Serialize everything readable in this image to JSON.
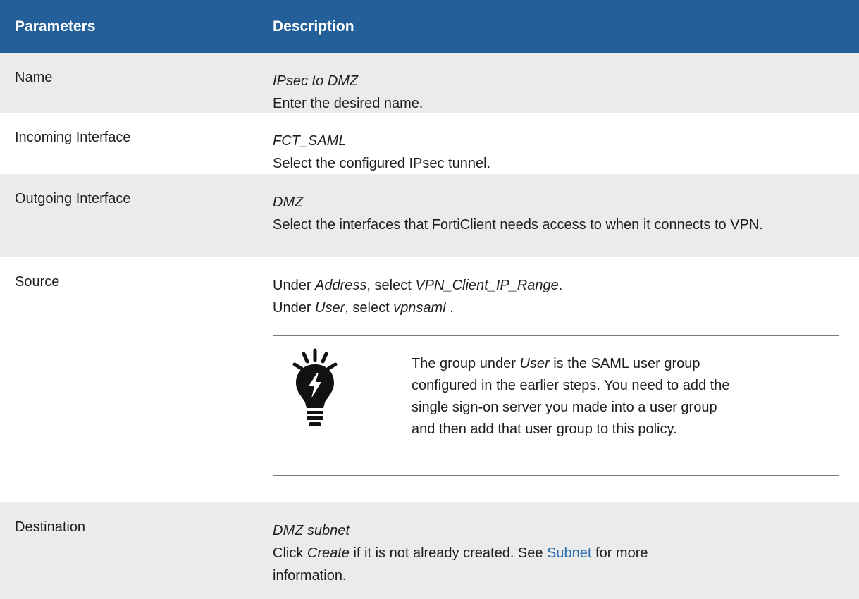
{
  "header": {
    "col1": "Parameters",
    "col2": "Description"
  },
  "rows": {
    "name": {
      "param": "Name",
      "value": "IPsec to DMZ",
      "desc": "Enter the desired name."
    },
    "incoming": {
      "param": "Incoming Interface",
      "value": "FCT_SAML",
      "desc": "Select the configured IPsec tunnel."
    },
    "outgoing": {
      "param": "Outgoing Interface",
      "value": "DMZ",
      "desc": "Select the interfaces that FortiClient needs access to when it connects to VPN."
    },
    "source": {
      "param": "Source",
      "line1": {
        "pre": "Under ",
        "field": "Address",
        "mid": ", select ",
        "value": "VPN_Client_IP_Range",
        "post": "."
      },
      "line2": {
        "pre": "Under ",
        "field": "User",
        "mid": ", select ",
        "value": "vpnsaml",
        "post": " ."
      },
      "note": {
        "pre": "The group under ",
        "field": "User",
        "post": " is the SAML user group configured in the earlier steps. You need to add the single sign-on server you made into a user group and then add that user group to this policy.",
        "icon": "lightbulb-icon"
      }
    },
    "destination": {
      "param": "Destination",
      "value": "DMZ subnet",
      "pre": "Click ",
      "action": "Create",
      "mid": " if it is not already created. See ",
      "link": "Subnet",
      "post": " for more information."
    }
  },
  "colors": {
    "header_bg": "#23609a",
    "shade": "#ebebeb",
    "link": "#2a6fb0"
  }
}
